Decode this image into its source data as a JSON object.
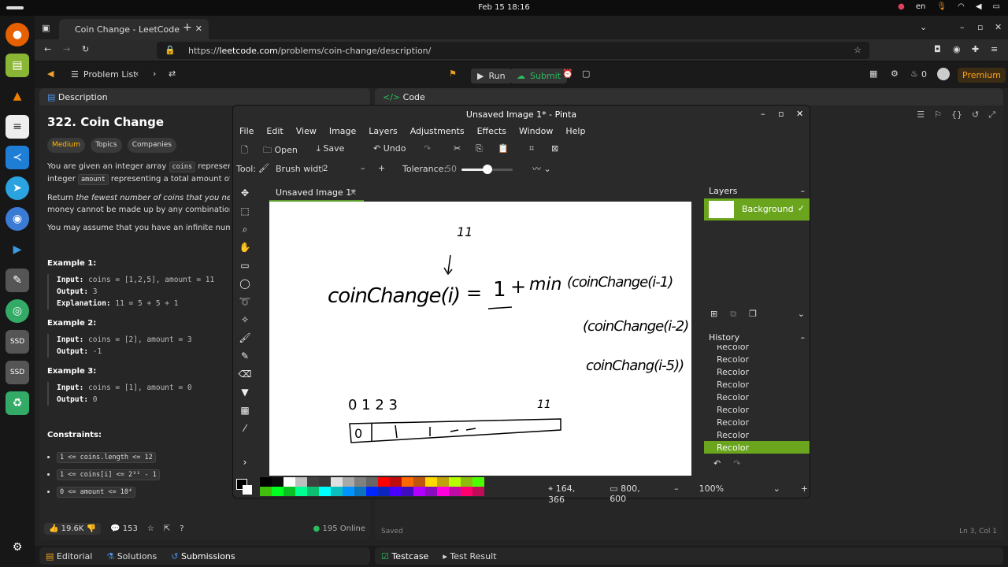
{
  "system": {
    "clock": "Feb 15  18:16",
    "lang": "en"
  },
  "browser": {
    "tab_title": "Coin Change - LeetCode",
    "url_prefix": "https://",
    "url_host": "leetcode.com",
    "url_path": "/problems/coin-change/description/"
  },
  "leetcode": {
    "problem_list": "Problem List",
    "run": "Run",
    "submit": "Submit",
    "premium": "Premium",
    "streak": "0",
    "desc_tab": "Description",
    "code_tab": "Code",
    "title": "322. Coin Change",
    "tags": [
      "Medium",
      "Topics",
      "Companies"
    ],
    "p1a": "You are given an integer array ",
    "p1_code1": "coins",
    "p1b": " representing coins",
    "p1c": "integer ",
    "p1_code2": "amount",
    "p1d": " representing a total amount of money.",
    "p2a": "Return ",
    "p2_em": "the fewest number of coins that you need to mak",
    "p2b": "money cannot be made up by any combination of the co",
    "p3": "You may assume that you have an infinite number of ea",
    "examples": [
      {
        "title": "Example 1:",
        "input": "coins = [1,2,5], amount = 11",
        "output": "3",
        "explanation": "11 = 5 + 5 + 1"
      },
      {
        "title": "Example 2:",
        "input": "coins = [2], amount = 3",
        "output": "-1"
      },
      {
        "title": "Example 3:",
        "input": "coins = [1], amount = 0",
        "output": "0"
      }
    ],
    "labels": {
      "input": "Input:",
      "output": "Output:",
      "explanation": "Explanation:"
    },
    "constraints_title": "Constraints:",
    "constraints": [
      "1 <= coins.length <= 12",
      "1 <= coins[i] <= 2³¹ - 1",
      "0 <= amount <= 10⁴"
    ],
    "likes": "19.6K",
    "comments": "153",
    "online": "195 Online",
    "saved": "Saved",
    "cursor": "Ln 3, Col 1",
    "bottom_tabs": [
      "Editorial",
      "Solutions",
      "Submissions"
    ],
    "test_tabs": [
      "Testcase",
      "Test Result"
    ]
  },
  "pinta": {
    "title": "Unsaved Image 1* - Pinta",
    "menu": [
      "File",
      "Edit",
      "View",
      "Image",
      "Layers",
      "Adjustments",
      "Effects",
      "Window",
      "Help"
    ],
    "toolbar": {
      "open": "Open",
      "save": "Save",
      "undo": "Undo"
    },
    "tool_label": "Tool:",
    "brush_label": "Brush width:",
    "brush_value": "2",
    "tolerance_label": "Tolerance:",
    "tolerance_value": "50",
    "tolerance_fraction": 0.5,
    "image_tab": "Unsaved Image 1*",
    "layers_title": "Layers",
    "layer_name": "Background",
    "history_title": "History",
    "history": [
      "Recolor",
      "Recolor",
      "Recolor",
      "Recolor",
      "Recolor",
      "Recolor",
      "Recolor",
      "Recolor",
      "Recolor"
    ],
    "position": "164, 366",
    "size": "800, 600",
    "zoom": "100%",
    "drawing": {
      "top_number": "11",
      "expr_left": "coinChange(i)",
      "expr_eq": "=",
      "expr_one": "1",
      "expr_plus": "+",
      "expr_min": "min",
      "expr_c1": "(coinChange(i-1)",
      "expr_c2": "(coinChange(i-2)",
      "expr_c3": "coinChang(i-5))",
      "nums": "0  1  2  3",
      "last": "11",
      "zero": "0"
    }
  }
}
